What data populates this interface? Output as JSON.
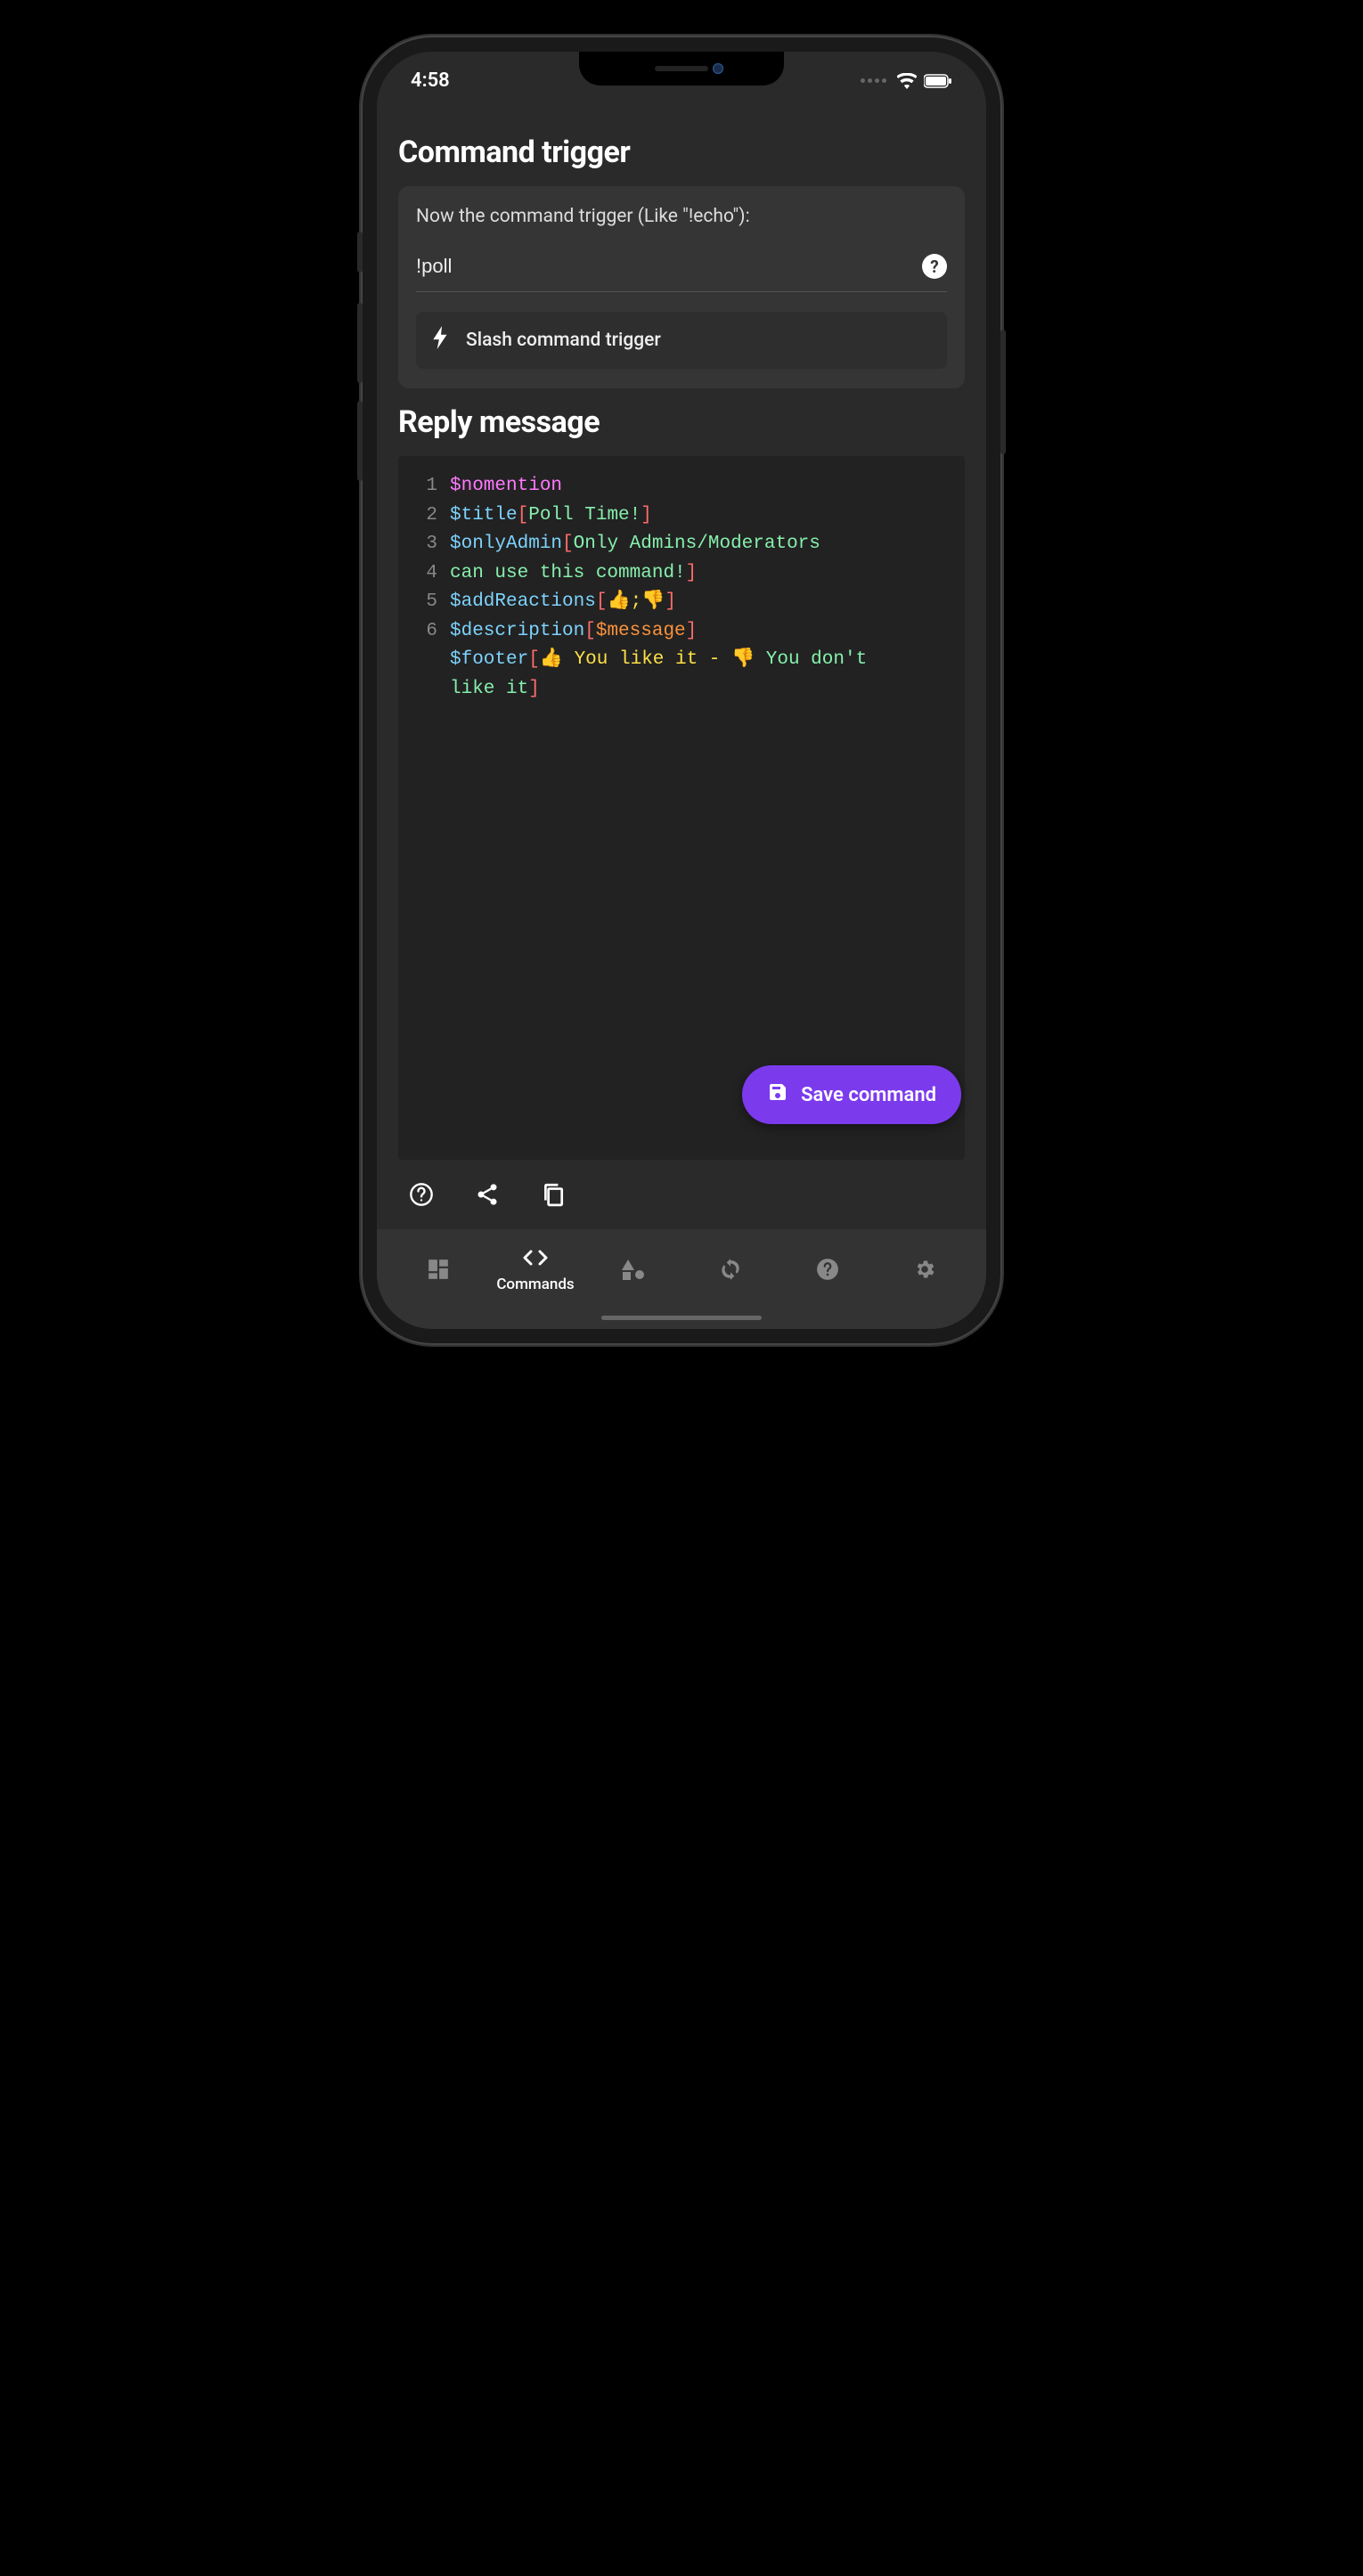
{
  "status": {
    "time": "4:58"
  },
  "trigger": {
    "heading": "Command trigger",
    "label": "Now the command trigger (Like \"!echo\"):",
    "value": "!poll",
    "slash_label": "Slash command trigger"
  },
  "reply": {
    "heading": "Reply message",
    "code": {
      "l1_fn": "$nomention",
      "l2_fn": "$title",
      "l2_arg": "Poll Time!",
      "l3_fn": "$onlyAdmin",
      "l3_arg": "Only Admins/Moderators",
      "l4_cont": "can use this command!",
      "l5_fn": "$addReactions",
      "l5_arg": "👍;👎",
      "l6a_fn": "$description",
      "l6a_arg": "$message",
      "l6b_fn": "$footer",
      "l6b_pre": "👍 You like it - 👎 ",
      "l6b_post": "You don't",
      "l7_cont": "like it"
    }
  },
  "fab": {
    "label": "Save command"
  },
  "nav": {
    "commands": "Commands"
  }
}
